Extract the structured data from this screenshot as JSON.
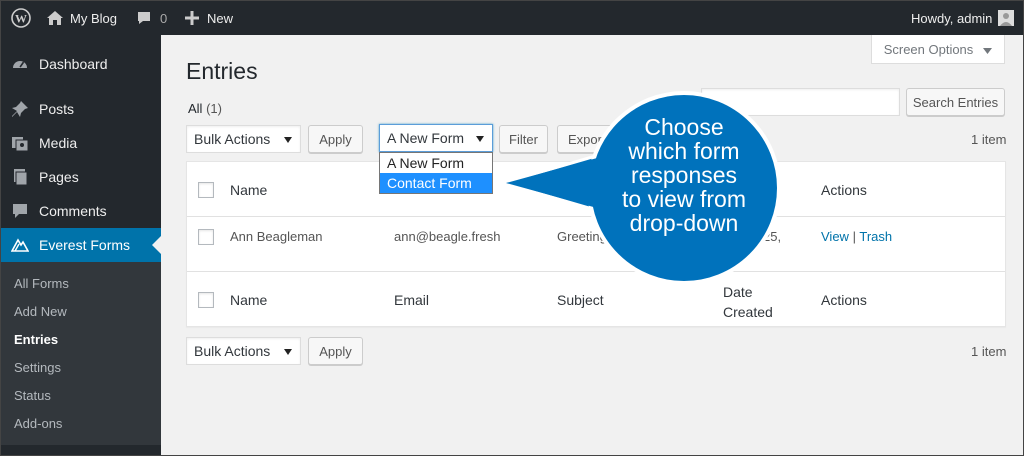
{
  "adminbar": {
    "site_name": "My Blog",
    "comments_count": "0",
    "new_label": "New",
    "howdy": "Howdy, admin"
  },
  "sidebar": {
    "items": [
      {
        "label": "Dashboard",
        "icon": "dashboard-icon"
      },
      {
        "label": "Posts",
        "icon": "pin-icon"
      },
      {
        "label": "Media",
        "icon": "media-icon"
      },
      {
        "label": "Pages",
        "icon": "pages-icon"
      },
      {
        "label": "Comments",
        "icon": "comment-icon"
      },
      {
        "label": "Everest Forms",
        "icon": "everest-forms-icon"
      }
    ],
    "submenu": [
      "All Forms",
      "Add New",
      "Entries",
      "Settings",
      "Status",
      "Add-ons"
    ]
  },
  "screen_options": "Screen Options",
  "page_title": "Entries",
  "filter": {
    "all_label": "All",
    "all_count": "(1)"
  },
  "toolbar_top": {
    "bulk_actions": "Bulk Actions",
    "apply": "Apply",
    "form_select": "A New Form",
    "filter": "Filter",
    "export": "Export",
    "items": "1 item"
  },
  "search": {
    "button": "Search Entries"
  },
  "dropdown": {
    "options": [
      "A New Form",
      "Contact Form"
    ]
  },
  "table": {
    "headers": {
      "name": "Name",
      "email": "Email",
      "subject": "Subject",
      "date": "Date Created",
      "actions": "Actions"
    },
    "row": {
      "name": "Ann Beagleman",
      "email": "ann@beagle.fresh",
      "subject": "Greeting",
      "date": "25,",
      "view": "View",
      "sep": "|",
      "trash": "Trash"
    }
  },
  "toolbar_bottom": {
    "bulk_actions": "Bulk Actions",
    "apply": "Apply",
    "items": "1 item"
  },
  "callout": {
    "lines": [
      "Choose",
      "which form",
      "responses",
      "to view from",
      "drop-down"
    ],
    "color": "#0072BC"
  }
}
